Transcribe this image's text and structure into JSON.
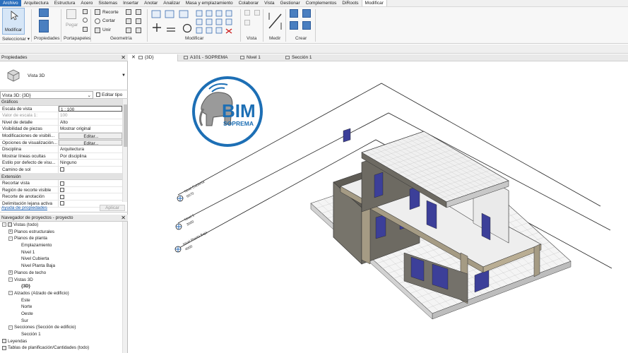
{
  "menu": [
    "Archivo",
    "Arquitectura",
    "Estructura",
    "Acero",
    "Sistemas",
    "Insertar",
    "Anotar",
    "Analizar",
    "Masa y emplazamiento",
    "Colaborar",
    "Vista",
    "Gestionar",
    "Complementos",
    "DiRoots",
    "Modificar"
  ],
  "ribbon": {
    "modify_label": "Modificar",
    "select_label": "Seleccionar ▾",
    "properties_label": "Propiedades",
    "clipboard_label": "Portapapeles",
    "paste_label": "Pegar",
    "cope_label": "Recorte",
    "cut_label": "Cortar",
    "join_label": "Unir",
    "geometry_label": "Geometría",
    "modify_panel_label": "Modificar",
    "view_label": "Vista",
    "measure_label": "Medir",
    "create_label": "Crear"
  },
  "properties": {
    "title": "Propiedades",
    "type_name": "Vista 3D",
    "instance": "Vista 3D: {3D}",
    "edit_type": "Editar tipo",
    "groups": [
      {
        "name": "Gráficos",
        "rows": [
          {
            "k": "Escala de vista",
            "v": "1 : 100",
            "style": "box"
          },
          {
            "k": "Valor de escala    1:",
            "v": "100",
            "style": "dim"
          },
          {
            "k": "Nivel de detalle",
            "v": "Alto"
          },
          {
            "k": "Visibilidad de piezas",
            "v": "Mostrar original"
          },
          {
            "k": "Modificaciones de visibili...",
            "v": "Editar...",
            "style": "btn"
          },
          {
            "k": "Opciones de visualización...",
            "v": "Editar...",
            "style": "btn"
          },
          {
            "k": "Disciplina",
            "v": "Arquitectura"
          },
          {
            "k": "Mostrar líneas ocultas",
            "v": "Por disciplina"
          },
          {
            "k": "Estilo por defecto de visu...",
            "v": "Ninguno"
          },
          {
            "k": "Camino de sol",
            "v": "",
            "style": "chk"
          }
        ]
      },
      {
        "name": "Extensión",
        "rows": [
          {
            "k": "Recortar vista",
            "v": "",
            "style": "chk"
          },
          {
            "k": "Región de recorte visible",
            "v": "",
            "style": "chk"
          },
          {
            "k": "Recorte de anotación",
            "v": "",
            "style": "chk"
          },
          {
            "k": "Delimitación lejana activa",
            "v": "",
            "style": "chk"
          }
        ]
      }
    ],
    "help_link": "Ayuda de propiedades",
    "apply": "Aplicar"
  },
  "browser": {
    "title": "Navegador de proyectos - proyecto",
    "nodes": [
      {
        "label": "Vistas (todo)",
        "indent": 0,
        "toggle": "-",
        "icon": true
      },
      {
        "label": "Planos estructurales",
        "indent": 1,
        "toggle": "+"
      },
      {
        "label": "Planos de planta",
        "indent": 1,
        "toggle": "-"
      },
      {
        "label": "Emplazamiento",
        "indent": 3,
        "toggle": ""
      },
      {
        "label": "Nivel 1",
        "indent": 3,
        "toggle": ""
      },
      {
        "label": "Nivel Cubierta",
        "indent": 3,
        "toggle": ""
      },
      {
        "label": "Nivel Planta Baja",
        "indent": 3,
        "toggle": ""
      },
      {
        "label": "Planos de techo",
        "indent": 1,
        "toggle": "+"
      },
      {
        "label": "Vistas 3D",
        "indent": 1,
        "toggle": "-"
      },
      {
        "label": "{3D}",
        "indent": 3,
        "toggle": "",
        "bold": true
      },
      {
        "label": "Alzados (Alzado de edificio)",
        "indent": 1,
        "toggle": "-"
      },
      {
        "label": "Este",
        "indent": 3,
        "toggle": ""
      },
      {
        "label": "Norte",
        "indent": 3,
        "toggle": ""
      },
      {
        "label": "Oeste",
        "indent": 3,
        "toggle": ""
      },
      {
        "label": "Sur",
        "indent": 3,
        "toggle": ""
      },
      {
        "label": "Secciones (Sección de edificio)",
        "indent": 1,
        "toggle": "-"
      },
      {
        "label": "Sección 1",
        "indent": 3,
        "toggle": ""
      },
      {
        "label": "Leyendas",
        "indent": 0,
        "toggle": "",
        "icon": true
      },
      {
        "label": "Tablas de planificación/Cantidades (todo)",
        "indent": 0,
        "toggle": "",
        "icon": true
      }
    ]
  },
  "tabs": [
    {
      "label": "{3D}",
      "active": true
    },
    {
      "label": "A101 - SOPREMA"
    },
    {
      "label": "Nivel 1"
    },
    {
      "label": "Sección 1"
    }
  ],
  "logo": {
    "main": "BIM",
    "sub": "SOPREMA",
    "color": "#1d6fb5"
  },
  "levels": [
    {
      "name": "Nivel Cubierta",
      "value": "6070"
    },
    {
      "name": "Nivel 1",
      "value": "3000"
    },
    {
      "name": "Nivel Planta Baja",
      "value": "4000"
    }
  ],
  "colors": {
    "accent": "#2b6fbd",
    "wall_dark": "#6d6a62",
    "wall_light": "#f2f2f2",
    "glass": "#3c3f99"
  }
}
